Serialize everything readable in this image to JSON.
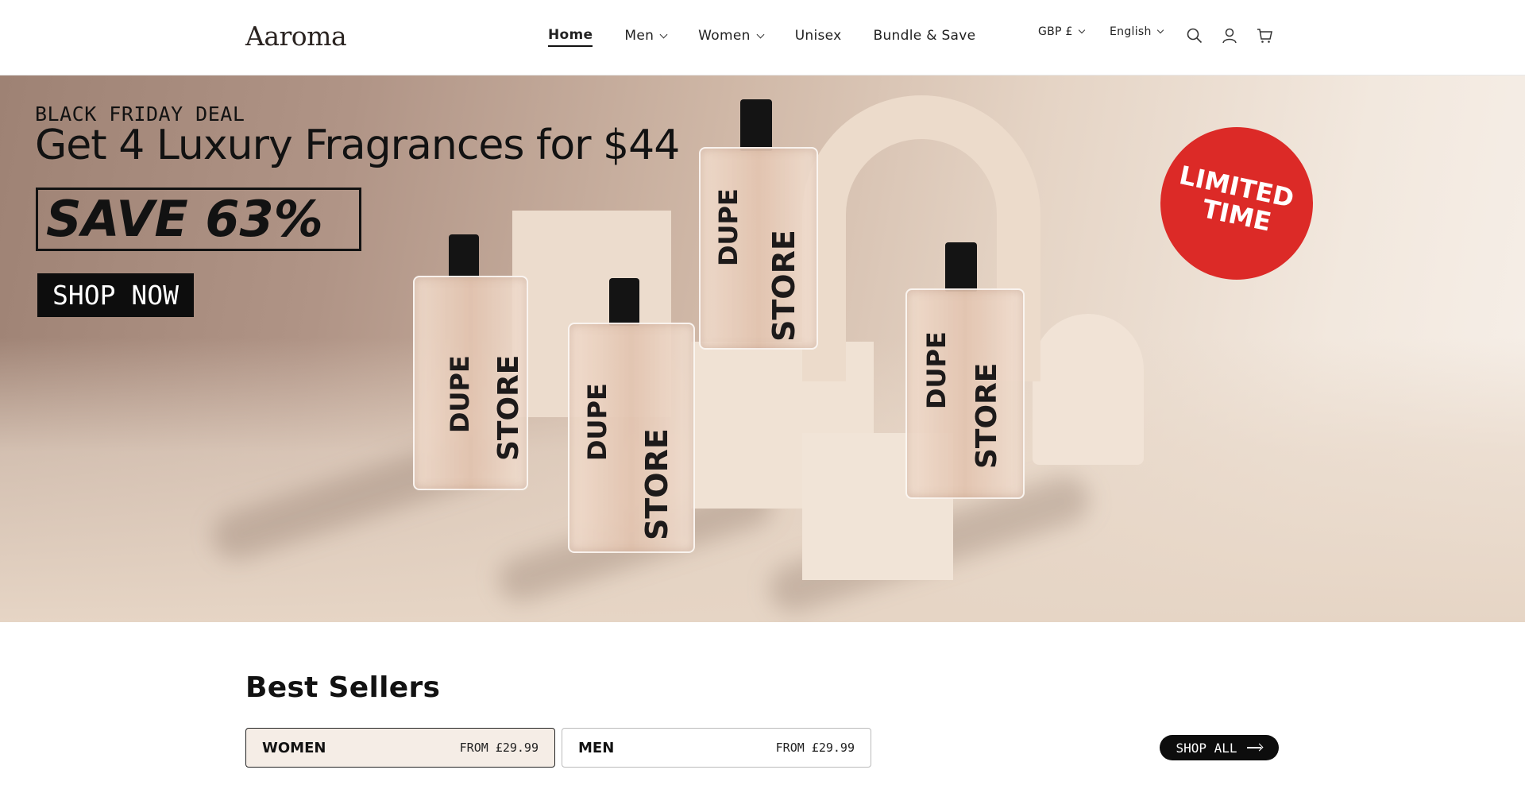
{
  "brand": {
    "logo": "Aaroma"
  },
  "nav": {
    "items": [
      {
        "label": "Home",
        "active": true,
        "dropdown": false
      },
      {
        "label": "Men",
        "active": false,
        "dropdown": true
      },
      {
        "label": "Women",
        "active": false,
        "dropdown": true
      },
      {
        "label": "Unisex",
        "active": false,
        "dropdown": false
      },
      {
        "label": "Bundle & Save",
        "active": false,
        "dropdown": false
      }
    ]
  },
  "utilities": {
    "currency": "GBP £",
    "language": "English",
    "icons": [
      "search-icon",
      "account-icon",
      "cart-icon"
    ]
  },
  "hero": {
    "eyebrow": "BLACK FRIDAY DEAL",
    "headline": "Get 4 Luxury Fragrances for $44",
    "save": "SAVE 63%",
    "cta": "SHOP NOW",
    "badge_line1": "LIMITED",
    "badge_line2": "TIME",
    "bottle_brand_1": "DUPE",
    "bottle_brand_2": "STORE",
    "badge_color": "#dc2a27"
  },
  "best_sellers": {
    "title": "Best Sellers",
    "tabs": [
      {
        "name": "WOMEN",
        "price": "FROM £29.99",
        "active": true
      },
      {
        "name": "MEN",
        "price": "FROM £29.99",
        "active": false
      }
    ],
    "shop_all": "SHOP ALL"
  }
}
